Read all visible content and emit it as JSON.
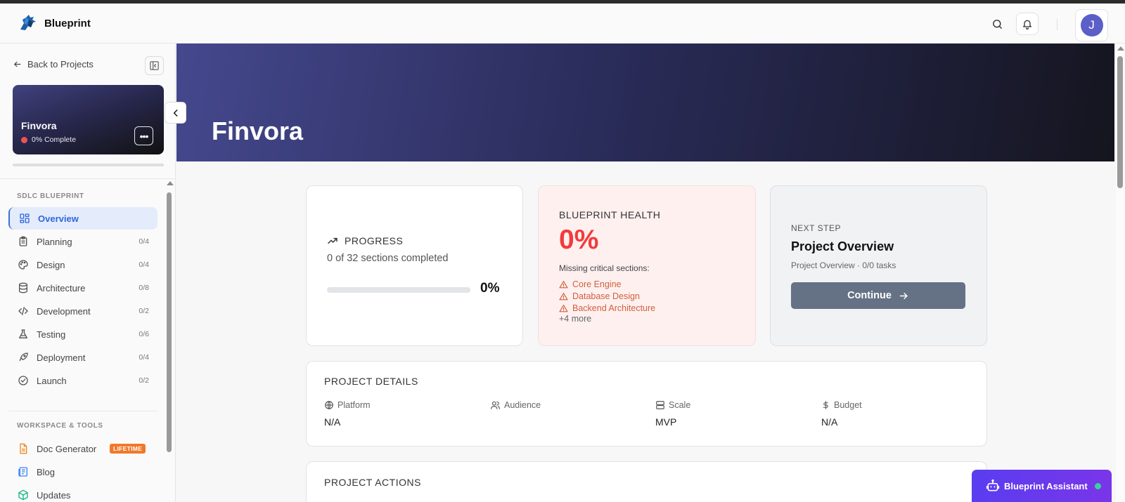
{
  "header": {
    "brand": "Blueprint",
    "avatar_initial": "J"
  },
  "sidebar": {
    "back_label": "Back to Projects",
    "project": {
      "name": "Finvora",
      "status": "0% Complete",
      "status_color": "#f05252",
      "more_icon": "•••"
    },
    "sections": {
      "sdlc": "SDLC BLUEPRINT",
      "workspace": "WORKSPACE & TOOLS"
    },
    "nav": [
      {
        "label": "Overview",
        "count": "",
        "icon": "grid-icon"
      },
      {
        "label": "Planning",
        "count": "0/4",
        "icon": "clipboard-icon"
      },
      {
        "label": "Design",
        "count": "0/4",
        "icon": "palette-icon"
      },
      {
        "label": "Architecture",
        "count": "0/8",
        "icon": "database-icon"
      },
      {
        "label": "Development",
        "count": "0/2",
        "icon": "code-icon"
      },
      {
        "label": "Testing",
        "count": "0/6",
        "icon": "flask-icon"
      },
      {
        "label": "Deployment",
        "count": "0/4",
        "icon": "rocket-icon"
      },
      {
        "label": "Launch",
        "count": "0/2",
        "icon": "check-circle-icon"
      }
    ],
    "tools": [
      {
        "label": "Doc Generator",
        "badge": "LIFETIME",
        "icon": "document-icon"
      },
      {
        "label": "Blog",
        "icon": "newspaper-icon"
      },
      {
        "label": "Updates",
        "icon": "package-icon"
      }
    ]
  },
  "hero": {
    "title": "Finvora"
  },
  "progress": {
    "heading": "PROGRESS",
    "sub": "0 of 32 sections completed",
    "percent": "0%",
    "fraction": 0
  },
  "health": {
    "heading": "BLUEPRINT HEALTH",
    "percent": "0%",
    "missing_label": "Missing critical sections:",
    "items": [
      "Core Engine",
      "Database Design",
      "Backend Architecture"
    ],
    "more": "+4 more"
  },
  "next_step": {
    "label": "NEXT STEP",
    "title": "Project Overview",
    "sub": "Project Overview · 0/0 tasks",
    "button": "Continue"
  },
  "details": {
    "heading": "PROJECT DETAILS",
    "fields": [
      {
        "label": "Platform",
        "value": "N/A",
        "icon": "globe-icon"
      },
      {
        "label": "Audience",
        "value": "",
        "icon": "users-icon"
      },
      {
        "label": "Scale",
        "value": "MVP",
        "icon": "server-icon"
      },
      {
        "label": "Budget",
        "value": "N/A",
        "icon": "dollar-icon"
      }
    ]
  },
  "actions": {
    "heading": "PROJECT ACTIONS"
  },
  "assistant": {
    "label": "Blueprint Assistant",
    "status_color": "#36d399"
  },
  "colors": {
    "accent": "#2f66e0",
    "danger": "#f23b3b",
    "warning": "#d0603a",
    "assistant": "#5a3df0"
  }
}
